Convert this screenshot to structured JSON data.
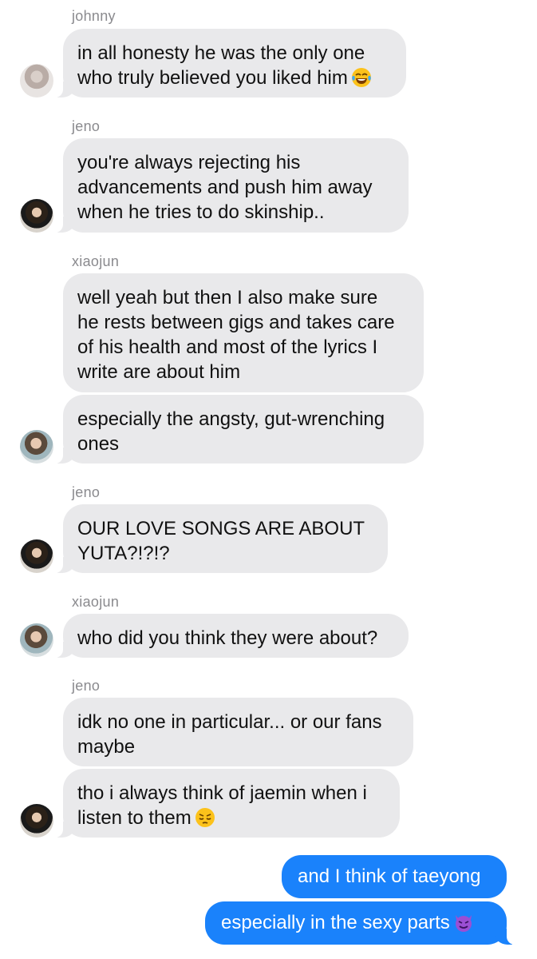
{
  "conversation": {
    "messages": [
      {
        "sender": "johnny",
        "lines": [
          "in all honesty he was the only one",
          "who truly believed you liked him"
        ],
        "emoji": "face-with-tears-of-joy"
      },
      {
        "sender": "jeno",
        "lines": [
          "you're always rejecting his",
          "advancements and push him away",
          "when he tries to do skinship.."
        ]
      },
      {
        "sender": "xiaojun",
        "lines": [
          "well yeah but then I also make sure",
          "he rests between gigs and takes care",
          "of his health and most of the lyrics I",
          "write are about him"
        ]
      },
      {
        "lines": [
          "especially the angsty, gut-wrenching",
          "ones"
        ]
      },
      {
        "sender": "jeno",
        "lines": [
          "OUR LOVE SONGS ARE ABOUT",
          "YUTA?!?!?"
        ]
      },
      {
        "sender": "xiaojun",
        "lines": [
          "who did you think they were about?"
        ]
      },
      {
        "sender": "jeno",
        "lines": [
          "idk no one in particular... or our fans",
          "maybe"
        ]
      },
      {
        "lines": [
          "tho i always think of jaemin when i",
          "listen to them"
        ],
        "emoji": "pensive-face"
      }
    ],
    "outgoing": [
      {
        "text": "and I think of taeyong"
      },
      {
        "text": "especially in the sexy parts",
        "emoji": "smiling-face-with-horns"
      }
    ]
  },
  "colors": {
    "incoming_bubble": "#e9e9eb",
    "outgoing_bubble": "#1a82fb",
    "sender_name": "#8a8a8e"
  }
}
